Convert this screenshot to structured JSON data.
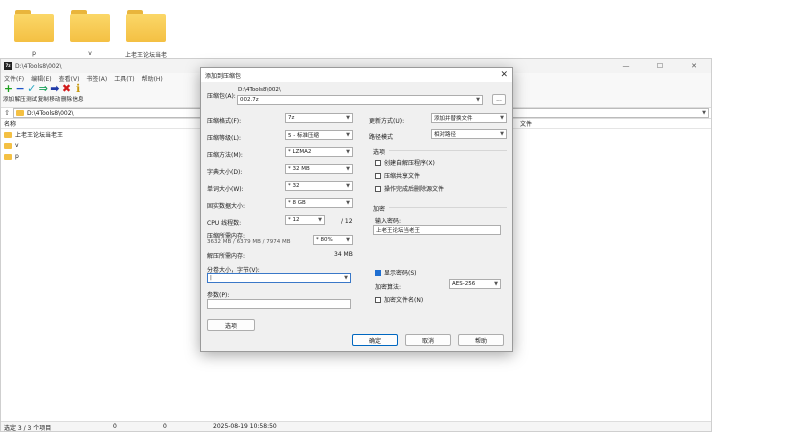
{
  "desktop": {
    "folders": [
      {
        "label": "p"
      },
      {
        "label": "v"
      },
      {
        "label": "上老王论坛当老"
      }
    ]
  },
  "main": {
    "title": "D:\\4Tools8\\002\\",
    "menu": [
      "文件(F)",
      "编辑(E)",
      "查看(V)",
      "书签(A)",
      "工具(T)",
      "帮助(H)"
    ],
    "toolbar": [
      {
        "label": "添加",
        "icon": "+",
        "color": "#1ea01e"
      },
      {
        "label": "解压",
        "icon": "−",
        "color": "#1f55c7"
      },
      {
        "label": "测试",
        "icon": "✓",
        "color": "#27a6c2"
      },
      {
        "label": "复制",
        "icon": "⇒",
        "color": "#1aa05a"
      },
      {
        "label": "移动",
        "icon": "➡",
        "color": "#1f3aa8"
      },
      {
        "label": "删除",
        "icon": "✖",
        "color": "#d11a1a"
      },
      {
        "label": "信息",
        "icon": "ℹ",
        "color": "#c89a10"
      }
    ],
    "address": "D:\\4Tools8\\002\\",
    "columns": {
      "name": "名称",
      "file": "文件"
    },
    "rows": [
      {
        "name": "上老王论坛当老王"
      },
      {
        "name": "v"
      },
      {
        "name": "p"
      }
    ],
    "status": {
      "selected": "选定 3 / 3 个项目",
      "v1": "0",
      "v2": "0",
      "time": "2025-08-19 10:58:50"
    }
  },
  "dialog": {
    "title": "添加到压缩包",
    "archive_label": "压缩包(A):",
    "archive_dir": "D:\\4Tools8\\002\\",
    "archive_name": "002.7z",
    "browse_label": "...",
    "format_label": "压缩格式(F):",
    "format_value": "7z",
    "level_label": "压缩等级(L):",
    "level_value": "5 - 标准压缩",
    "method_label": "压缩方法(M):",
    "method_value": "* LZMA2",
    "dict_label": "字典大小(D):",
    "dict_value": "* 32 MB",
    "word_label": "单词大小(W):",
    "word_value": "* 32",
    "solid_label": "固实数据大小:",
    "solid_value": "* 8 GB",
    "cpu_label": "CPU 线程数:",
    "cpu_value": "* 12",
    "cpu_total": "/ 12",
    "mem_label": "压缩所需内存:",
    "mem_detail": "3632 MB / 6379 MB / 7974 MB",
    "mem_percent": "* 80%",
    "decomp_label": "解压所需内存:",
    "decomp_value": "34 MB",
    "split_label": "分卷大小，字节(V):",
    "split_value": "|",
    "params_label": "参数(P):",
    "params_value": "",
    "options_btn": "选项",
    "update_label": "更新方式(U):",
    "update_value": "添加并替换文件",
    "path_label": "路径模式",
    "path_value": "相对路径",
    "options_group": "选项",
    "opt_sfx": "创建自解压程序(X)",
    "opt_shared": "压缩共享文件",
    "opt_delete": "操作完成后删除源文件",
    "enc_group": "加密",
    "pwd_label": "输入密码:",
    "pwd_value": "上老王论坛当老王",
    "show_pwd": "显示密码(S)",
    "enc_method_label": "加密算法:",
    "enc_method_value": "AES-256",
    "enc_names": "加密文件名(N)",
    "ok_btn": "确定",
    "cancel_btn": "取消",
    "help_btn": "帮助"
  }
}
